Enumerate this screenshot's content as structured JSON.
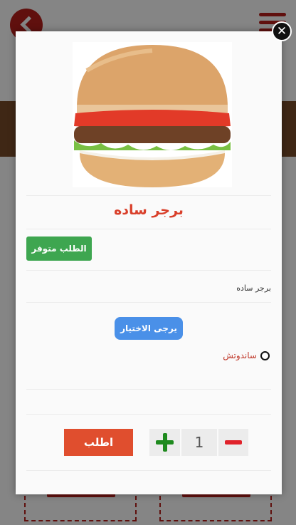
{
  "modal": {
    "close_glyph": "✕",
    "product_title": "برجر ساده",
    "availability_label": "الطلب متوفر",
    "description": "برجر ساده",
    "choose_label": "يرجى الاختيار",
    "options": [
      {
        "label": "ساندوتش",
        "selected": false
      }
    ],
    "quantity": "1",
    "order_label": "اطلب"
  },
  "colors": {
    "title": "#d9402b",
    "available": "#3ea650",
    "choose": "#4a90e8",
    "order": "#e04e2e",
    "brand": "#b8201c"
  },
  "icons": {
    "back": "back-arrow-icon",
    "menu": "hamburger-menu-icon",
    "close": "close-icon",
    "plus": "plus-icon",
    "minus": "minus-icon"
  }
}
